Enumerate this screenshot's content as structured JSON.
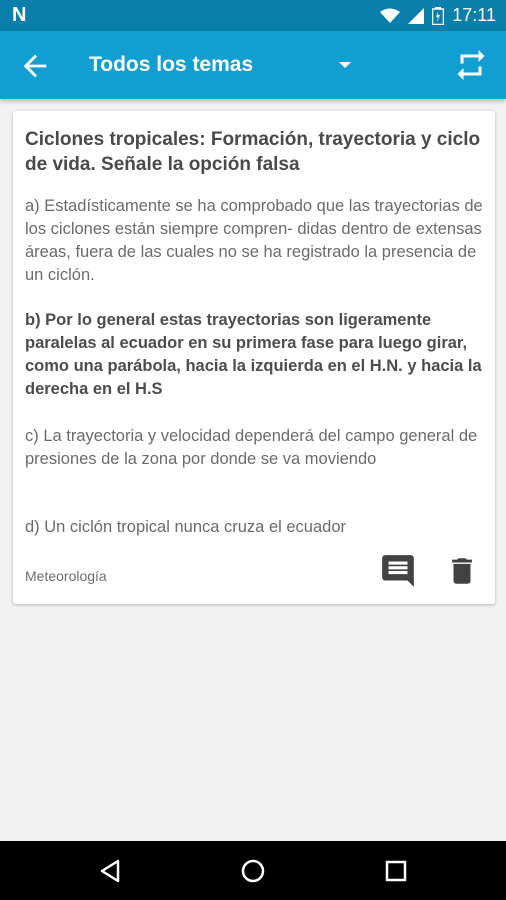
{
  "status_bar": {
    "notification_icon": "n-logo-icon",
    "time": "17:11",
    "icons": [
      "wifi-icon",
      "signal-icon",
      "battery-icon"
    ]
  },
  "app_bar": {
    "title": "Todos los temas",
    "back_icon": "arrow-left-icon",
    "dropdown_icon": "triangle-down-icon",
    "action_icon": "repeat-icon"
  },
  "question": {
    "title": "Ciclones tropicales: Formación, trayectoria y ciclo de vida. Señale la opción falsa",
    "options": [
      {
        "text": "a) Estadísticamente se ha comprobado que las trayectorias de los ciclones están siempre compren- didas dentro de extensas áreas, fuera de las cuales no se ha registrado la presencia de un ciclón.",
        "correct": false
      },
      {
        "text": "b) Por lo general estas trayectorias son ligeramente paralelas al ecuador en su primera fase para luego girar, como una parábola, hacia la izquierda en el H.N. y hacia la derecha en el H.S",
        "correct": true
      },
      {
        "text": "c) La trayectoria y velocidad dependerá del campo general de presiones de la zona por donde se va moviendo",
        "correct": false
      },
      {
        "text": "d) Un ciclón tropical nunca cruza el ecuador",
        "correct": false
      }
    ],
    "category": "Meteorología",
    "action_icons": [
      "comment-icon",
      "trash-icon"
    ]
  },
  "nav_bar": {
    "icons": [
      "back-triangle-icon",
      "home-circle-icon",
      "recents-square-icon"
    ]
  },
  "colors": {
    "status_bar": "#0a7fab",
    "app_bar": "#139ed2",
    "background": "#f1f1f1",
    "card": "#ffffff",
    "icon_dark": "#424242"
  }
}
